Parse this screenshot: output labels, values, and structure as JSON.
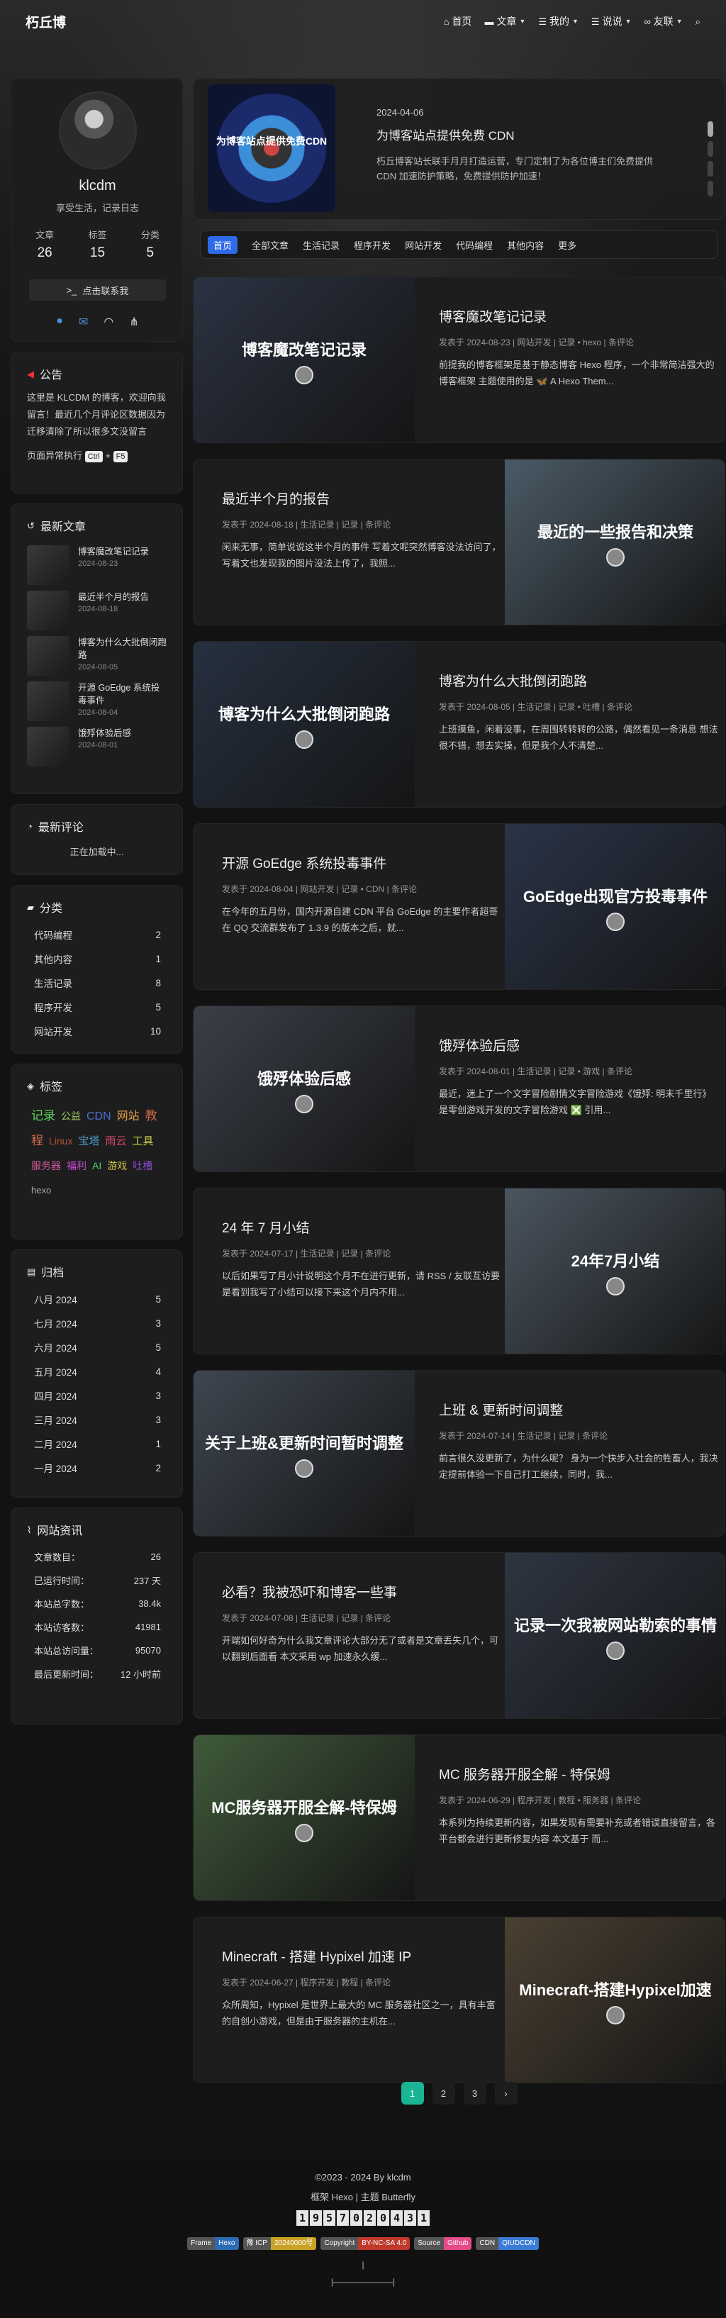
{
  "nav": {
    "site_name": "朽丘博",
    "items": [
      {
        "label": "首页",
        "icon": "home-icon",
        "glyph": "⌂",
        "dropdown": false
      },
      {
        "label": "文章",
        "icon": "folder-icon",
        "glyph": "▬",
        "dropdown": true
      },
      {
        "label": "我的",
        "icon": "list-icon",
        "glyph": "☰",
        "dropdown": true
      },
      {
        "label": "说说",
        "icon": "list-icon",
        "glyph": "☰",
        "dropdown": true
      },
      {
        "label": "友联",
        "icon": "link-icon",
        "glyph": "∞",
        "dropdown": true
      }
    ]
  },
  "profile": {
    "author": "klcdm",
    "description": "享受生活，记录日志",
    "stats": [
      {
        "label": "文章",
        "value": "26"
      },
      {
        "label": "标签",
        "value": "15"
      },
      {
        "label": "分类",
        "value": "5"
      }
    ],
    "contact_label": "点击联系我",
    "social_icons": [
      "github-icon",
      "email-icon",
      "rss-icon",
      "sitemap-icon"
    ]
  },
  "announcement": {
    "title": "公告",
    "text": "这里是 KLCDM 的博客，欢迎向我留言！最近几个月评论区数据因为迁移清除了所以很多文没留言",
    "hint_prefix": "页面异常执行",
    "key1": "Ctrl",
    "plus": "+",
    "key2": "F5"
  },
  "recent_posts": {
    "title": "最新文章",
    "items": [
      {
        "title": "博客魔改笔记记录",
        "date": "2024-08-23"
      },
      {
        "title": "最近半个月的报告",
        "date": "2024-08-18"
      },
      {
        "title": "博客为什么大批倒闭跑路",
        "date": "2024-08-05"
      },
      {
        "title": "开源 GoEdge 系统投毒事件",
        "date": "2024-08-04"
      },
      {
        "title": "饿殍体验后感",
        "date": "2024-08-01"
      }
    ]
  },
  "recent_comments": {
    "title": "最新评论",
    "loading": "正在加载中..."
  },
  "categories": {
    "title": "分类",
    "items": [
      {
        "name": "代码编程",
        "count": "2"
      },
      {
        "name": "其他内容",
        "count": "1"
      },
      {
        "name": "生活记录",
        "count": "8"
      },
      {
        "name": "程序开发",
        "count": "5"
      },
      {
        "name": "网站开发",
        "count": "10"
      }
    ]
  },
  "tags": {
    "title": "标签",
    "items": [
      {
        "name": "记录",
        "color": "#5bd15b",
        "size": "17px"
      },
      {
        "name": "公益",
        "color": "#9bcc5b",
        "size": "14px"
      },
      {
        "name": "CDN",
        "color": "#4a6fd1",
        "size": "16px"
      },
      {
        "name": "网站",
        "color": "#e0a04a",
        "size": "16px"
      },
      {
        "name": "教程",
        "color": "#d16a4a",
        "size": "17px"
      },
      {
        "name": "Linux",
        "color": "#b0562e",
        "size": "14px"
      },
      {
        "name": "宝塔",
        "color": "#4aa0d1",
        "size": "15px"
      },
      {
        "name": "雨云",
        "color": "#d14a6e",
        "size": "15px"
      },
      {
        "name": "工具",
        "color": "#c7c74a",
        "size": "15px"
      },
      {
        "name": "服务器",
        "color": "#d15b9b",
        "size": "14px"
      },
      {
        "name": "福利",
        "color": "#c94ad1",
        "size": "14px"
      },
      {
        "name": "AI",
        "color": "#4ad16a",
        "size": "14px"
      },
      {
        "name": "游戏",
        "color": "#d1c04a",
        "size": "14px"
      },
      {
        "name": "吐槽",
        "color": "#8a4ad1",
        "size": "14px"
      },
      {
        "name": "hexo",
        "color": "#aaaaaa",
        "size": "13px"
      }
    ]
  },
  "archives": {
    "title": "归档",
    "items": [
      {
        "month": "八月 2024",
        "count": "5"
      },
      {
        "month": "七月 2024",
        "count": "3"
      },
      {
        "month": "六月 2024",
        "count": "5"
      },
      {
        "month": "五月 2024",
        "count": "4"
      },
      {
        "month": "四月 2024",
        "count": "3"
      },
      {
        "month": "三月 2024",
        "count": "3"
      },
      {
        "month": "二月 2024",
        "count": "1"
      },
      {
        "month": "一月 2024",
        "count": "2"
      }
    ]
  },
  "site_info": {
    "title": "网站资讯",
    "items": [
      {
        "k": "文章数目：",
        "v": "26"
      },
      {
        "k": "已运行时间：",
        "v": "237 天"
      },
      {
        "k": "本站总字数：",
        "v": "38.4k"
      },
      {
        "k": "本站访客数：",
        "v": "41981"
      },
      {
        "k": "本站总访问量：",
        "v": "95070"
      },
      {
        "k": "最后更新时间：",
        "v": "12 小时前"
      }
    ]
  },
  "top_notice": {
    "image_caption": "为博客站点提供免费CDN",
    "date": "2024-04-06",
    "title": "为博客站点提供免费 CDN",
    "description": "朽丘博客站长联手月月打造运营，专门定制了为各位博主们免费提供 CDN 加速防护策略，免费提供防护加速！"
  },
  "category_bar": [
    "首页",
    "全部文章",
    "生活记录",
    "程序开发",
    "网站开发",
    "代码编程",
    "其他内容",
    "更多"
  ],
  "posts": [
    {
      "title": "博客魔改笔记记录",
      "image_caption": "博客魔改笔记记录",
      "meta": "发表于 2024-08-23 | 网站开发 | 记录 • hexo | 条评论",
      "desc": "前提我的博客框架是基于静态博客 Hexo 程序，一个非常简洁强大的博客框架 主题使用的是 🦋 A Hexo Them...",
      "bg": "#2b3242"
    },
    {
      "title": "最近半个月的报告",
      "image_caption": "最近的一些报告和决策",
      "meta": "发表于 2024-08-18 | 生活记录 | 记录 | 条评论",
      "desc": "闲来无事，简单说说这半个月的事件 写着文呢突然博客没法访问了，写着文也发现我的图片没法上传了，我照...",
      "bg": "#4a5a66"
    },
    {
      "title": "博客为什么大批倒闭跑路",
      "image_caption": "博客为什么大批倒闭跑路",
      "meta": "发表于 2024-08-05 | 生活记录 | 记录 • 吐槽 | 条评论",
      "desc": "上班摸鱼，闲着没事，在周围转转转的公路，偶然看见一条消息 想法很不错，想去实操，但是我个人不清楚...",
      "bg": "#263040"
    },
    {
      "title": "开源 GoEdge 系统投毒事件",
      "image_caption": "GoEdge出现官方投毒事件",
      "meta": "发表于 2024-08-04 | 网站开发 | 记录 • CDN | 条评论",
      "desc": "在今年的五月份，国内开源自建 CDN 平台 GoEdge 的主要作者超哥在 QQ 交流群发布了 1.3.9 的版本之后，就...",
      "bg": "#2a3448"
    },
    {
      "title": "饿殍体验后感",
      "image_caption": "饿殍体验后感",
      "meta": "发表于 2024-08-01 | 生活记录 | 记录 • 游戏 | 条评论",
      "desc": "最近，迷上了一个文字冒险剧情文字冒险游戏《饿殍: 明末千里行》是零创游戏开发的文字冒险游戏 ❎ 引用...",
      "bg": "#3a3f48"
    },
    {
      "title": "24 年 7 月小结",
      "image_caption": "24年7月小结",
      "meta": "发表于 2024-07-17 | 生活记录 | 记录 | 条评论",
      "desc": "以后如果写了月小计说明这个月不在进行更新，请 RSS / 友联互访要是看到我写了小结可以接下来这个月内不用...",
      "bg": "#4a5560"
    },
    {
      "title": "上班 & 更新时间调整",
      "image_caption": "关于上班&更新时间暂时调整",
      "meta": "发表于 2024-07-14 | 生活记录 | 记录 | 条评论",
      "desc": "前言很久没更新了，为什么呢？ 身为一个快步入社会的牲畜人，我决定提前体验一下自己打工继续，同时，我...",
      "bg": "#3e4650"
    },
    {
      "title": "必看？我被恐吓和博客一些事",
      "image_caption": "记录一次我被网站勒索的事情",
      "meta": "发表于 2024-07-08 | 生活记录 | 记录 | 条评论",
      "desc": "开端如何好奇为什么我文章评论大部分无了或者是文章丢失几个，可以翻到后面看 本文采用 wp 加速永久缓...",
      "bg": "#2e3542"
    },
    {
      "title": "MC 服务器开服全解 - 特保姆",
      "image_caption": "MC服务器开服全解-特保姆",
      "meta": "发表于 2024-06-29 | 程序开发 | 教程 • 服务器 | 条评论",
      "desc": "本系列为持续更新内容，如果发现有需要补充或者错误直接留言，各平台都会进行更新修复内容 本文基于 而...",
      "bg": "#3f5a3a"
    },
    {
      "title": "Minecraft - 搭建 Hypixel 加速 IP",
      "image_caption": "Minecraft-搭建Hypixel加速",
      "meta": "发表于 2024-06-27 | 程序开发 | 教程 | 条评论",
      "desc": "众所周知，Hypixel 是世界上最大的 MC 服务器社区之一，具有丰富的自创小游戏，但是由于服务器的主机在...",
      "bg": "#4a4032"
    }
  ],
  "pager": {
    "pages": [
      "1",
      "2",
      "3"
    ],
    "next": "›"
  },
  "footer": {
    "copyright": "©2023 - 2024 By klcdm",
    "framework": "框架 Hexo | 主题 Butterfly",
    "counter": "1957020431",
    "badges": [
      {
        "l": "Frame",
        "r": "Hexo",
        "color": "#2b6bb3"
      },
      {
        "l": "豫 ICP",
        "r": "20240000号",
        "color": "#c9a227"
      },
      {
        "l": "Copyright",
        "r": "BY-NC-SA 4.0",
        "color": "#c0392b"
      },
      {
        "l": "Source",
        "r": "Github",
        "color": "#e64a8b"
      },
      {
        "l": "CDN",
        "r": "QIUDCDN",
        "color": "#3a7bd5"
      }
    ],
    "line3": "|",
    "line4": "|———————|"
  }
}
